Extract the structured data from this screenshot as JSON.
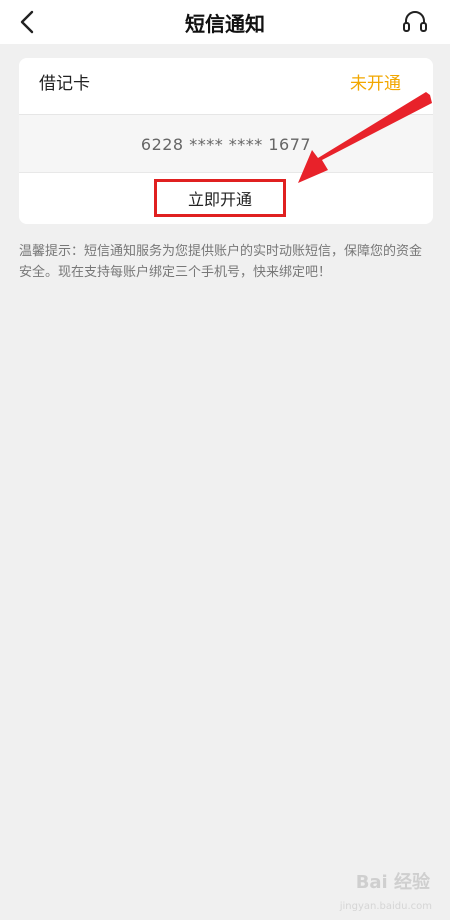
{
  "header": {
    "title": "短信通知",
    "back_icon": "chevron-left-icon",
    "support_icon": "headset-icon"
  },
  "card": {
    "type": "借记卡",
    "status": "未开通",
    "number": "6228 **** **** 1677",
    "action_label": "立即开通"
  },
  "tips": {
    "text": "温馨提示：短信通知服务为您提供账户的实时动账短信，保障您的资金安全。现在支持每账户绑定三个手机号，快来绑定吧！"
  },
  "watermark": {
    "text": "Bai 经验",
    "sub": "jingyan.baidu.com"
  },
  "colors": {
    "status": "#f2a700",
    "highlight": "#e02020"
  }
}
